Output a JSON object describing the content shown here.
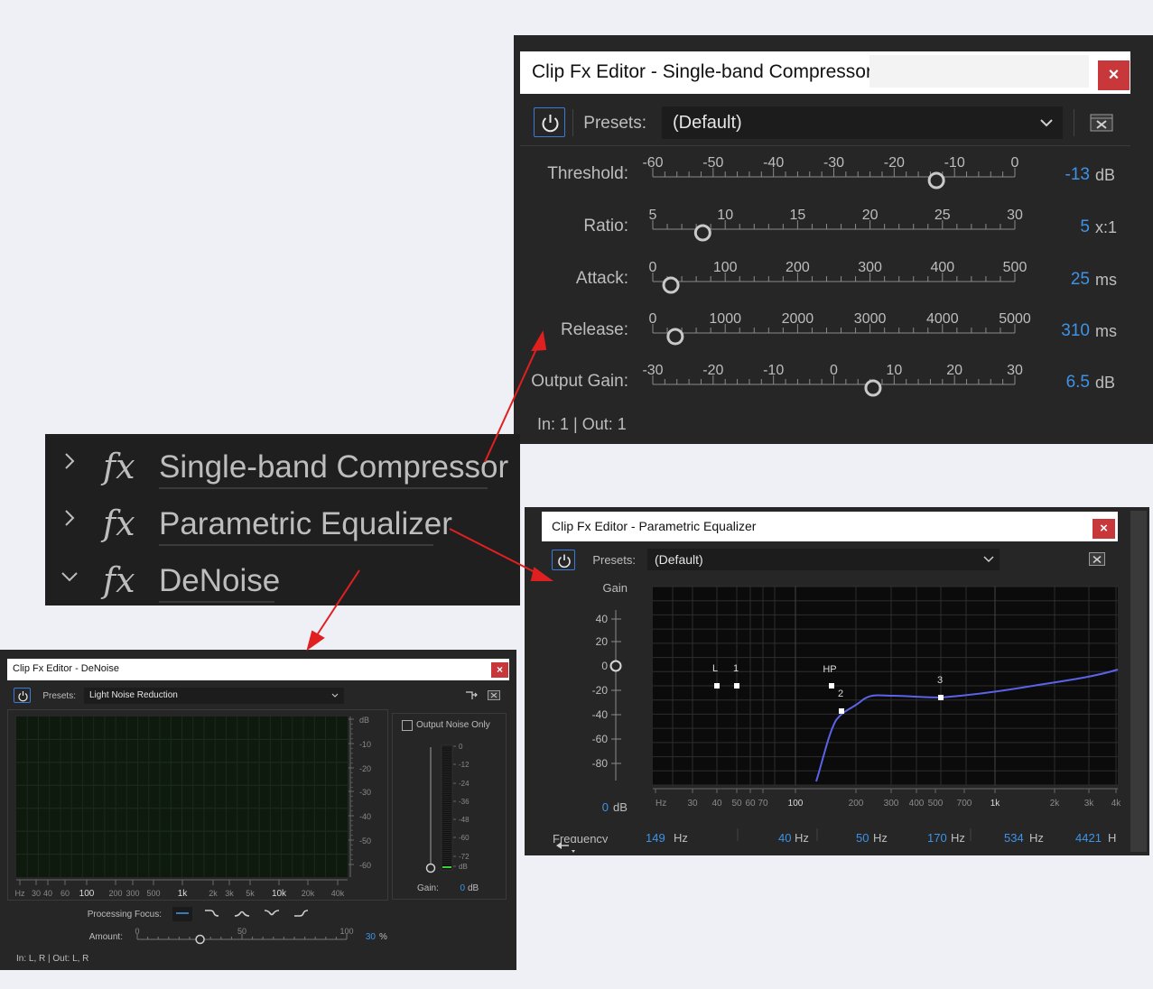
{
  "compressor": {
    "title": "Clip Fx Editor - Single-band Compressor",
    "close": "×",
    "presets_label": "Presets:",
    "preset_value": "(Default)",
    "io": "In: 1 | Out: 1",
    "params": [
      {
        "label": "Threshold:",
        "ticks": [
          "-60",
          "-50",
          "-40",
          "-30",
          "-20",
          "-10",
          "0"
        ],
        "min": -60,
        "max": 0,
        "value": -13,
        "value_text": "-13",
        "unit": "dB"
      },
      {
        "label": "Ratio:",
        "ticks": [
          "5",
          "10",
          "15",
          "20",
          "25",
          "30"
        ],
        "min": 1,
        "max": 30,
        "value": 5,
        "value_text": "5",
        "unit": "x:1"
      },
      {
        "label": "Attack:",
        "ticks": [
          "0",
          "100",
          "200",
          "300",
          "400",
          "500"
        ],
        "min": 0,
        "max": 500,
        "value": 25,
        "value_text": "25",
        "unit": "ms"
      },
      {
        "label": "Release:",
        "ticks": [
          "0",
          "1000",
          "2000",
          "3000",
          "4000",
          "5000"
        ],
        "min": 0,
        "max": 5000,
        "value": 310,
        "value_text": "310",
        "unit": "ms"
      },
      {
        "label": "Output Gain:",
        "ticks": [
          "-30",
          "-20",
          "-10",
          "0",
          "10",
          "20",
          "30"
        ],
        "min": -30,
        "max": 30,
        "value": 6.5,
        "value_text": "6.5",
        "unit": "dB"
      }
    ]
  },
  "effects_list": {
    "fx_glyph": "fx",
    "items": [
      {
        "name": "Single-band Compressor",
        "expanded": false,
        "chevron": "›"
      },
      {
        "name": "Parametric Equalizer",
        "expanded": false,
        "chevron": "›"
      },
      {
        "name": "DeNoise",
        "expanded": true,
        "chevron": "⌄"
      }
    ]
  },
  "equalizer": {
    "title": "Clip Fx Editor - Parametric Equalizer",
    "close": "×",
    "presets_label": "Presets:",
    "preset_value": "(Default)",
    "gain_label": "Gain",
    "gain_ticks": [
      "40",
      "20",
      "0",
      "-20",
      "-40",
      "-60",
      "-80"
    ],
    "gain_value": "0",
    "gain_unit": "dB",
    "freq_ticks": [
      "Hz",
      "30",
      "40",
      "50",
      "60",
      "70",
      "100",
      "200",
      "300",
      "400",
      "500",
      "700",
      "1k",
      "2k",
      "3k",
      "4k"
    ],
    "nodes": [
      {
        "label": "L"
      },
      {
        "label": "1"
      },
      {
        "label": "HP"
      },
      {
        "label": "2"
      },
      {
        "label": "3"
      }
    ],
    "frequency_label": "Frequency",
    "freq_values": [
      {
        "value": "149",
        "unit": "Hz"
      },
      {
        "value": "40",
        "unit": "Hz"
      },
      {
        "value": "50",
        "unit": "Hz"
      },
      {
        "value": "170",
        "unit": "Hz"
      },
      {
        "value": "534",
        "unit": "Hz"
      },
      {
        "value": "4421",
        "unit": "H"
      }
    ]
  },
  "denoise": {
    "title": "Clip Fx Editor - DeNoise",
    "close": "×",
    "presets_label": "Presets:",
    "preset_value": "Light Noise Reduction",
    "db_ticks": [
      "dB",
      "-10",
      "-20",
      "-30",
      "-40",
      "-50",
      "-60"
    ],
    "hz_ticks": [
      "Hz",
      "30",
      "40",
      "60",
      "100",
      "200",
      "300",
      "500",
      "1k",
      "2k",
      "3k",
      "5k",
      "10k",
      "20k",
      "40k"
    ],
    "output_noise_only": "Output Noise Only",
    "meter_ticks": [
      "0",
      "-12",
      "-24",
      "-36",
      "-48",
      "-60",
      "-72",
      "dB"
    ],
    "gain_label": "Gain:",
    "gain_value": "0",
    "gain_unit": "dB",
    "processing_focus_label": "Processing Focus:",
    "amount_label": "Amount:",
    "amount_ticks": [
      "0",
      "50",
      "100"
    ],
    "amount_value": 30,
    "amount_text": "30",
    "amount_unit": "%",
    "io": "In: L, R | Out: L, R"
  },
  "colors": {
    "panel": "#262626",
    "accent_blue": "#3f93e6",
    "close_red": "#c8373a",
    "arrow_red": "#e02020",
    "eq_curve": "#5b63e8"
  }
}
